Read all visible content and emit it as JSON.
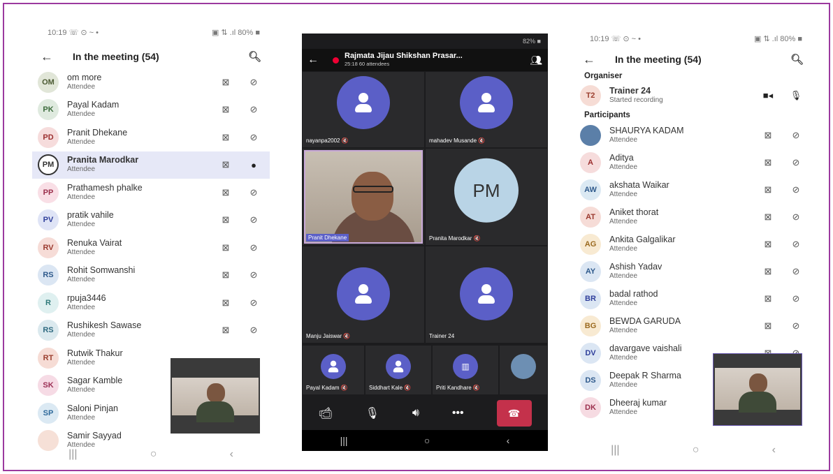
{
  "left": {
    "status_time": "10:19 ☏ ⊙ ~ •",
    "status_right": "▣ ⇅ .ıl 80% ■",
    "title": "In the meeting (54)",
    "role": "Attendee",
    "participants": [
      {
        "initials": "OM",
        "name": "om more",
        "bg": "#e1e6d8",
        "fg": "#4b5a32",
        "mic": "off"
      },
      {
        "initials": "PK",
        "name": "Payal Kadam",
        "bg": "#dfeadf",
        "fg": "#3b6a3b",
        "mic": "off"
      },
      {
        "initials": "PD",
        "name": "Pranit Dhekane",
        "bg": "#f6dcdc",
        "fg": "#9b2f2f",
        "mic": "off"
      },
      {
        "initials": "PM",
        "name": "Pranita Marodkar",
        "bg": "#fff",
        "fg": "#333",
        "mic": "on",
        "selected": true
      },
      {
        "initials": "PP",
        "name": "Prathamesh phalke",
        "bg": "#f9dfe6",
        "fg": "#9b2f4c",
        "mic": "off"
      },
      {
        "initials": "PV",
        "name": "pratik vahile",
        "bg": "#dfe4f6",
        "fg": "#2f3f9b",
        "mic": "off"
      },
      {
        "initials": "RV",
        "name": "Renuka Vairat",
        "bg": "#f6dcd7",
        "fg": "#9b3a2f",
        "mic": "off"
      },
      {
        "initials": "RS",
        "name": "Rohit Somwanshi",
        "bg": "#dbe6f3",
        "fg": "#2f5a8c",
        "mic": "off"
      },
      {
        "initials": "R",
        "name": "rpuja3446",
        "bg": "#dff0f0",
        "fg": "#2f7a7a",
        "mic": "off"
      },
      {
        "initials": "RS",
        "name": "Rushikesh Sawase",
        "bg": "#dbe9ee",
        "fg": "#2f6a80",
        "mic": "off"
      },
      {
        "initials": "RT",
        "name": "Rutwik Thakur",
        "bg": "#f6dcd5",
        "fg": "#9b3f2f",
        "mic": "none"
      },
      {
        "initials": "SK",
        "name": "Sagar Kamble",
        "bg": "#f6dbe5",
        "fg": "#9b2f55",
        "mic": "none"
      },
      {
        "initials": "SP",
        "name": "Saloni Pinjan",
        "bg": "#dbe9f3",
        "fg": "#2f6a9b",
        "mic": "none"
      },
      {
        "initials": "",
        "name": "Samir Sayyad",
        "bg": "#f6e0d7",
        "fg": "#9b4a2f",
        "mic": "none"
      }
    ]
  },
  "mid": {
    "status_battery": "82% ■",
    "meeting_title": "Rajmata Jijau Shikshan Prasar...",
    "meeting_sub": "25:18  60 attendees",
    "tiles": [
      {
        "label": "nayanpa2002 🔇"
      },
      {
        "label": "mahadev Musande 🔇"
      },
      {
        "label": "Pranit Dhekane"
      },
      {
        "label": "Pranita Marodkar 🔇",
        "initials": "PM"
      },
      {
        "label": "Manju Jaiswar 🔇"
      },
      {
        "label": "Trainer 24"
      }
    ],
    "strip": [
      {
        "label": "Payal Kadam 🔇"
      },
      {
        "label": "Siddhart Kale 🔇"
      },
      {
        "label": "Priti Kandhare 🔇"
      }
    ]
  },
  "right": {
    "status_time": "10:19 ☏ ⊙ ~ •",
    "status_right": "▣ ⇅ .ıl 80% ■",
    "title": "In the meeting (54)",
    "organiser_header": "Organiser",
    "organiser": {
      "initials": "T2",
      "name": "Trainer 24",
      "sub": "Started recording"
    },
    "participants_header": "Participants",
    "role": "Attendee",
    "participants": [
      {
        "initials": "",
        "name": "SHAURYA KADAM",
        "bg": "#5b7fa8",
        "fg": "#fff",
        "photo": true
      },
      {
        "initials": "A",
        "name": "Aditya",
        "bg": "#f6dcdc",
        "fg": "#9b2f2f"
      },
      {
        "initials": "AW",
        "name": "akshata Waikar",
        "bg": "#dbe9f3",
        "fg": "#2f5a8c"
      },
      {
        "initials": "AT",
        "name": "Aniket thorat",
        "bg": "#f6dcd7",
        "fg": "#9b3a2f"
      },
      {
        "initials": "AG",
        "name": "Ankita Galgalikar",
        "bg": "#f8ead2",
        "fg": "#9b6a1f"
      },
      {
        "initials": "AY",
        "name": "Ashish Yadav",
        "bg": "#dbe6f3",
        "fg": "#2f5a8c"
      },
      {
        "initials": "BR",
        "name": "badal rathod",
        "bg": "#dbe6f3",
        "fg": "#2f3f9b"
      },
      {
        "initials": "BG",
        "name": "BEWDA GARUDA",
        "bg": "#f8ead2",
        "fg": "#9b6a1f"
      },
      {
        "initials": "DV",
        "name": "davargave vaishali",
        "bg": "#dbe6f3",
        "fg": "#2f3f9b"
      },
      {
        "initials": "DS",
        "name": "Deepak R Sharma",
        "bg": "#dbe6f3",
        "fg": "#2f5a8c"
      },
      {
        "initials": "DK",
        "name": "Dheeraj kumar",
        "bg": "#f6dbe2",
        "fg": "#9b2f4c"
      }
    ]
  }
}
